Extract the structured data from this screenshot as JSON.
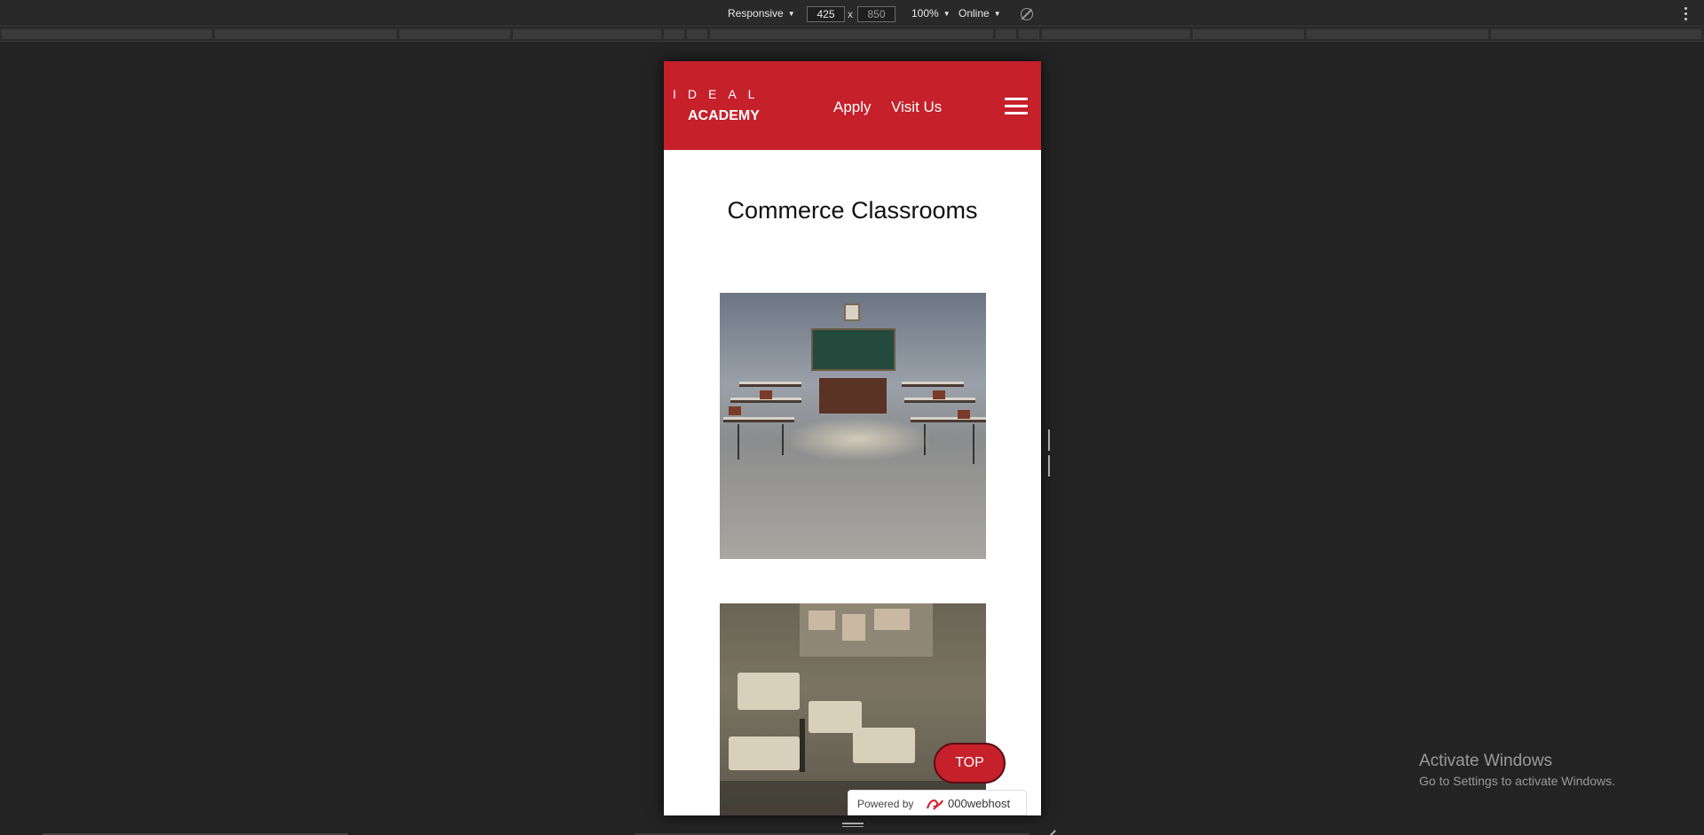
{
  "devtools": {
    "device_mode": "Responsive",
    "width": "425",
    "height": "850",
    "dim_separator": "x",
    "zoom": "100%",
    "network": "Online",
    "icons": [
      "rotate-icon",
      "more-options-icon"
    ]
  },
  "site": {
    "logo_top": "IDEAL",
    "logo_bottom": "ACADEMY",
    "nav": [
      "Apply",
      "Visit Us"
    ],
    "menu_icon": "hamburger-icon",
    "title": "Commerce Classrooms",
    "brand_color": "#c6202a",
    "top_button": "TOP"
  },
  "hosting_badge": {
    "prefix": "Powered by",
    "brand": "000webhost"
  },
  "os_watermark": {
    "title": "Activate Windows",
    "subtitle": "Go to Settings to activate Windows."
  }
}
